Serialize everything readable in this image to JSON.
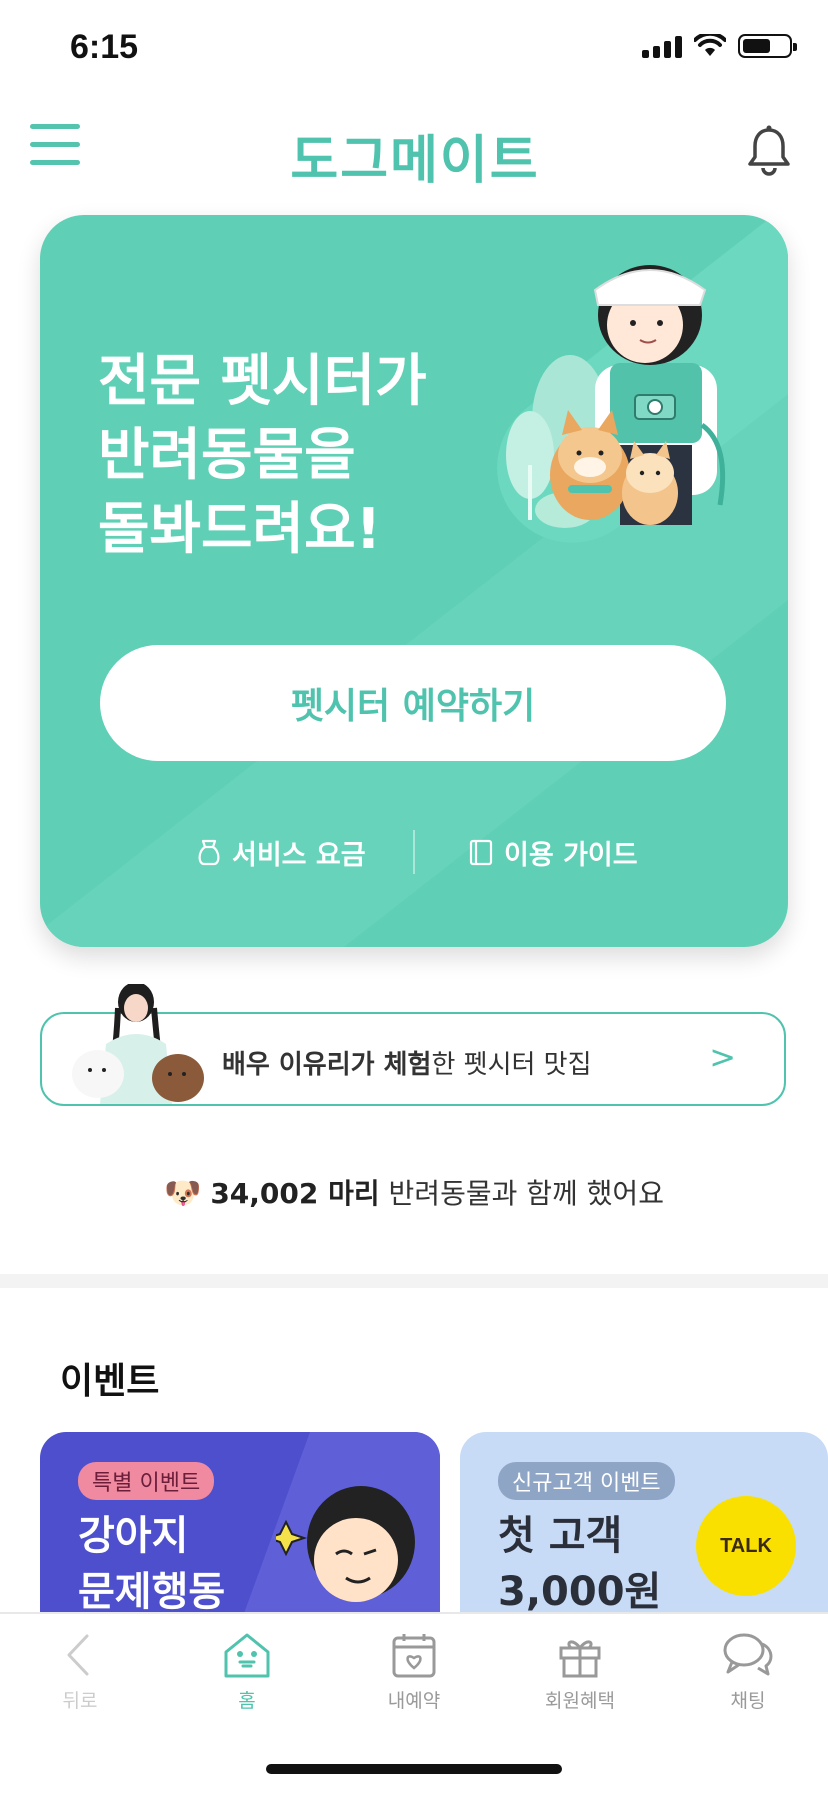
{
  "status_bar": {
    "time": "6:15"
  },
  "header": {
    "logo_text": "도그메이트"
  },
  "hero": {
    "title": "전문 펫시터가\n반려동물을\n돌봐드려요!",
    "reserve_button": "펫시터 예약하기",
    "service_fee_link": "서비스 요금",
    "guide_link": "이용 가이드"
  },
  "promo": {
    "highlight_text": "배우 이유리가 체험",
    "rest_text": "한 펫시터 맛집",
    "arrow": ">"
  },
  "counter": {
    "emoji": "🐶",
    "count_text": "34,002 마리",
    "suffix": "반려동물과 함께 했어요"
  },
  "events": {
    "section_title": "이벤트",
    "cards": [
      {
        "badge": "특별 이벤트",
        "title": "강아지\n문제행동"
      },
      {
        "badge": "신규고객 이벤트",
        "title": "첫 고객\n3,000원",
        "talk_label": "TALK"
      }
    ]
  },
  "bottom_nav": {
    "items": [
      {
        "label": "뒤로"
      },
      {
        "label": "홈"
      },
      {
        "label": "내예약"
      },
      {
        "label": "회원혜택"
      },
      {
        "label": "채팅"
      }
    ]
  },
  "colors": {
    "brand": "#4fc3ad",
    "hero_bg": "#5fcfb5",
    "event1_bg": "#4d4fcc",
    "event2_bg": "#c7dbf6"
  }
}
